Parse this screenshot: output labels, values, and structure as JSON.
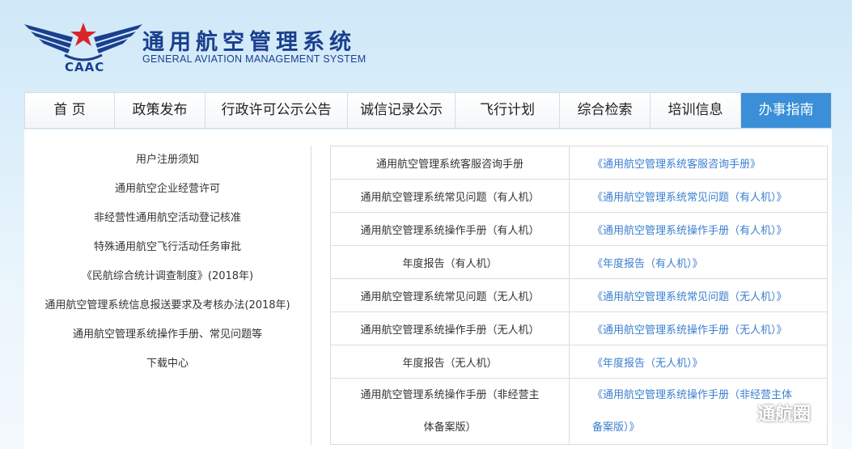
{
  "header": {
    "logo_text": "CAAC",
    "title": "通用航空管理系统",
    "subtitle": "GENERAL AVIATION MANAGEMENT SYSTEM"
  },
  "nav": {
    "items": [
      {
        "label": "首 页"
      },
      {
        "label": "政策发布"
      },
      {
        "label": "行政许可公示公告"
      },
      {
        "label": "诚信记录公示"
      },
      {
        "label": "飞行计划"
      },
      {
        "label": "综合检索"
      },
      {
        "label": "培训信息"
      },
      {
        "label": "办事指南"
      }
    ],
    "active_index": 7
  },
  "sidebar": {
    "items": [
      {
        "label": "用户注册须知"
      },
      {
        "label": "通用航空企业经营许可"
      },
      {
        "label": "非经营性通用航空活动登记核准"
      },
      {
        "label": "特殊通用航空飞行活动任务审批"
      },
      {
        "label": "《民航综合统计调查制度》(2018年)"
      },
      {
        "label": "通用航空管理系统信息报送要求及考核办法(2018年)"
      },
      {
        "label": "通用航空管理系统操作手册、常见问题等"
      },
      {
        "label": "下载中心"
      }
    ]
  },
  "table": {
    "rows": [
      {
        "name": "通用航空管理系统客服咨询手册",
        "link": "《通用航空管理系统客服咨询手册》"
      },
      {
        "name": "通用航空管理系统常见问题（有人机）",
        "link": "《通用航空管理系统常见问题（有人机）》"
      },
      {
        "name": "通用航空管理系统操作手册（有人机）",
        "link": "《通用航空管理系统操作手册（有人机）》"
      },
      {
        "name": "年度报告（有人机）",
        "link": "《年度报告（有人机）》"
      },
      {
        "name": "通用航空管理系统常见问题（无人机）",
        "link": "《通用航空管理系统常见问题（无人机）》"
      },
      {
        "name": "通用航空管理系统操作手册（无人机）",
        "link": "《通用航空管理系统操作手册（无人机）》"
      },
      {
        "name": "年度报告（无人机）",
        "link": "《年度报告（无人机）》"
      },
      {
        "name_line1": "通用航空管理系统操作手册（非经营主",
        "name_line2": "体备案版）",
        "link_line1": "《通用航空管理系统操作手册（非经营主体",
        "link_line2": "备案版）》"
      }
    ]
  },
  "watermark": {
    "text": "通航圈"
  },
  "colors": {
    "accent": "#3a8fd8",
    "brand": "#1a3f8f",
    "link": "#3a7fd0",
    "logo_red": "#d8262b"
  }
}
